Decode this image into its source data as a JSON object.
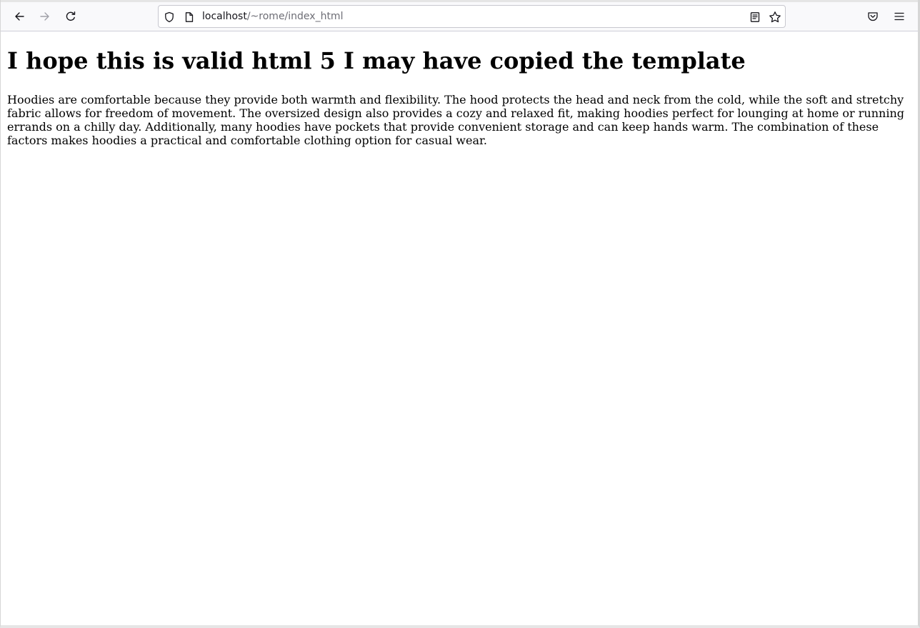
{
  "browser": {
    "url_host": "localhost",
    "url_path": "/~rome/index_html",
    "icons": {
      "back": "arrow-left-icon",
      "forward": "arrow-right-icon",
      "reload": "reload-icon",
      "tracking": "shield-icon",
      "page_info": "page-icon",
      "reader": "reader-view-icon",
      "bookmark": "star-icon",
      "pocket": "pocket-icon",
      "menu": "hamburger-menu-icon"
    }
  },
  "page": {
    "heading": "I hope this is valid html 5 I may have copied the template",
    "paragraph": "Hoodies are comfortable because they provide both warmth and flexibility. The hood protects the head and neck from the cold, while the soft and stretchy fabric allows for freedom of movement. The oversized design also provides a cozy and relaxed fit, making hoodies perfect for lounging at home or running errands on a chilly day. Additionally, many hoodies have pockets that provide convenient storage and can keep hands warm. The combination of these factors makes hoodies a practical and comfortable clothing option for casual wear."
  }
}
